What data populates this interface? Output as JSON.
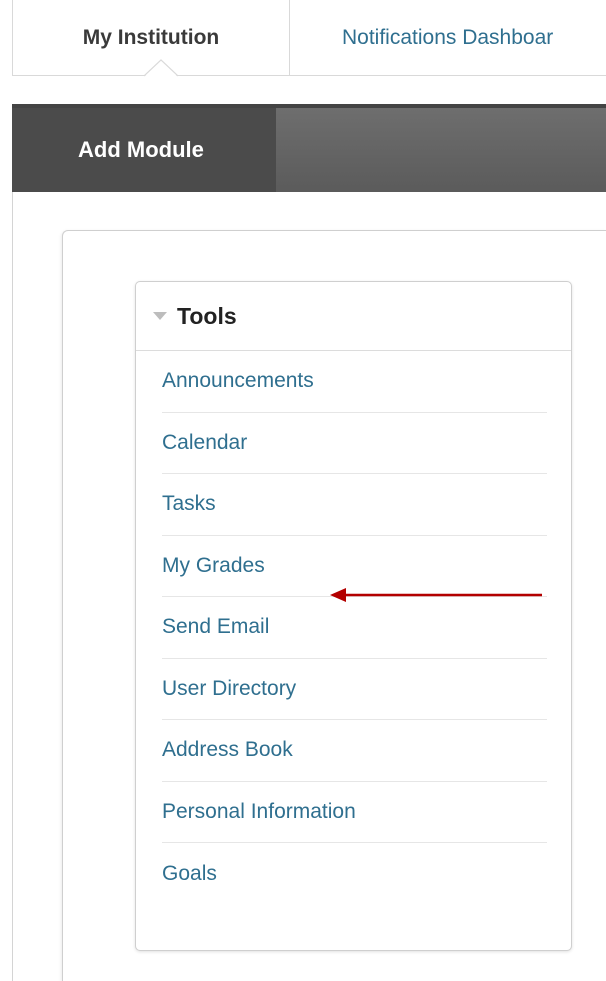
{
  "tabs": {
    "my_institution": "My Institution",
    "notifications": "Notifications Dashboar"
  },
  "toolbar": {
    "add_module": "Add Module"
  },
  "tools": {
    "title": "Tools",
    "items": [
      {
        "label": "Announcements"
      },
      {
        "label": "Calendar"
      },
      {
        "label": "Tasks"
      },
      {
        "label": "My Grades"
      },
      {
        "label": "Send Email"
      },
      {
        "label": "User Directory"
      },
      {
        "label": "Address Book"
      },
      {
        "label": "Personal Information"
      },
      {
        "label": "Goals"
      }
    ]
  },
  "colors": {
    "link": "#2f6f8f",
    "toolbar": "#5b5b5b",
    "annotation_arrow": "#b30000"
  },
  "annotation": {
    "arrow_points_to": "My Grades"
  }
}
